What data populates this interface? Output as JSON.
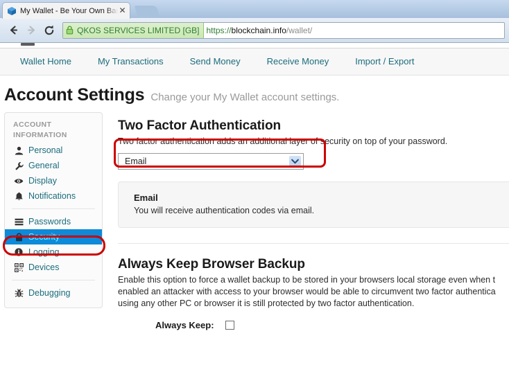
{
  "browser": {
    "tab": {
      "title": "My Wallet - Be Your Own Ban",
      "close_label": "✕",
      "favicon_name": "blue-cube-favicon"
    },
    "toolbar": {
      "back_label": "Back",
      "forward_label": "Forward",
      "reload_label": "Reload"
    },
    "omnibox": {
      "ev_certificate": "QKOS SERVICES LIMITED [GB]",
      "url_scheme": "https://",
      "url_host": "blockchain.info",
      "url_path": "/wallet/",
      "lock_color": "#5aa832",
      "ev_text_color": "#2e7d32"
    }
  },
  "mainnav": {
    "items": [
      {
        "label": "Wallet Home"
      },
      {
        "label": "My Transactions"
      },
      {
        "label": "Send Money"
      },
      {
        "label": "Receive Money"
      },
      {
        "label": "Import / Export"
      }
    ]
  },
  "page": {
    "title": "Account Settings",
    "subtitle": "Change your My Wallet account settings."
  },
  "sidebar": {
    "heading_line1": "ACCOUNT",
    "heading_line2": "INFORMATION",
    "items": [
      {
        "label": "Personal",
        "icon": "user-icon",
        "active": false
      },
      {
        "label": "General",
        "icon": "wrench-icon",
        "active": false
      },
      {
        "label": "Display",
        "icon": "eye-icon",
        "active": false
      },
      {
        "label": "Notifications",
        "icon": "bell-icon",
        "active": false
      },
      {
        "label": "Passwords",
        "icon": "list-icon",
        "active": false
      },
      {
        "label": "Security",
        "icon": "lock-icon",
        "active": true
      },
      {
        "label": "Logging",
        "icon": "info-icon",
        "active": false
      },
      {
        "label": "Devices",
        "icon": "qrcode-icon",
        "active": false
      },
      {
        "label": "Debugging",
        "icon": "bug-icon",
        "active": false
      }
    ],
    "active_highlight_color": "#0e8ad8",
    "active_label_color": "#7df3ff",
    "link_color": "#1b6c7d"
  },
  "annotations": {
    "color": "#cc0000",
    "security_ring_label": "red-highlight-security",
    "select_ring_label": "red-highlight-two-factor-select"
  },
  "two_factor": {
    "title": "Two Factor Authentication",
    "description": "Two factor authentication adds an additional layer of security on top of your password.",
    "select": {
      "value": "Email",
      "options": [
        "Email"
      ]
    },
    "info": {
      "title": "Email",
      "description": "You will receive authentication codes via email."
    }
  },
  "browser_backup": {
    "title": "Always Keep Browser Backup",
    "description_line1": "Enable this option to force a wallet backup to be stored in your browsers local storage even when t",
    "description_line2": "enabled an attacker with access to your browser would be able to circumvent two factor authentica",
    "description_line3": "using any other PC or browser it is still protected by two factor authentication.",
    "checkbox_label": "Always Keep:",
    "checkbox_checked": false
  }
}
